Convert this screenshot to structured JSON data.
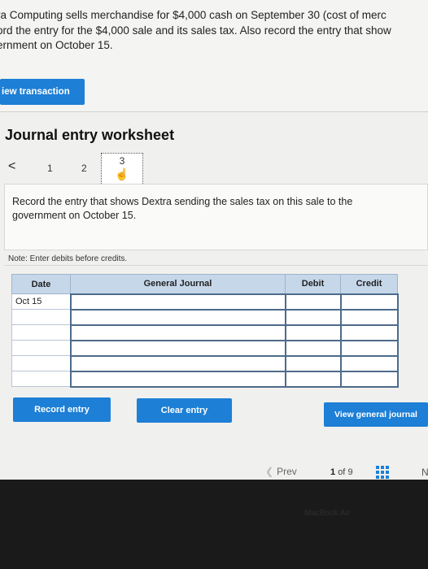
{
  "problem": {
    "lines": [
      "ra Computing sells merchandise for $4,000 cash on September 30 (cost of merc",
      "ord the entry for the $4,000 sale and its sales tax. Also record the entry that show",
      "ernment on October 15."
    ]
  },
  "toolbar": {
    "view_transactions_label": "iew transaction list"
  },
  "worksheet": {
    "title": "Journal entry worksheet",
    "nav": {
      "prev": "<",
      "step1": "1",
      "step2": "2",
      "step3": "3"
    },
    "instruction": "Record the entry that shows Dextra sending the sales tax on this sale to the government on October 15.",
    "note": "Note: Enter debits before credits."
  },
  "journal": {
    "headers": [
      "Date",
      "General Journal",
      "Debit",
      "Credit"
    ],
    "rows": [
      [
        "Oct 15",
        "",
        "",
        ""
      ],
      [
        "",
        "",
        "",
        ""
      ],
      [
        "",
        "",
        "",
        ""
      ],
      [
        "",
        "",
        "",
        ""
      ],
      [
        "",
        "",
        "",
        ""
      ],
      [
        "",
        "",
        "",
        ""
      ]
    ]
  },
  "actions": {
    "record": "Record entry",
    "clear": "Clear entry",
    "view_general_journal": "View general journal"
  },
  "pager": {
    "prev": "Prev",
    "current": "1",
    "of": "of",
    "total": "9",
    "next": "N"
  },
  "bezel": {
    "brand": "MacBook Air"
  },
  "colors": {
    "accent": "#1d7fd6",
    "header_bg": "#c6d7ea"
  }
}
